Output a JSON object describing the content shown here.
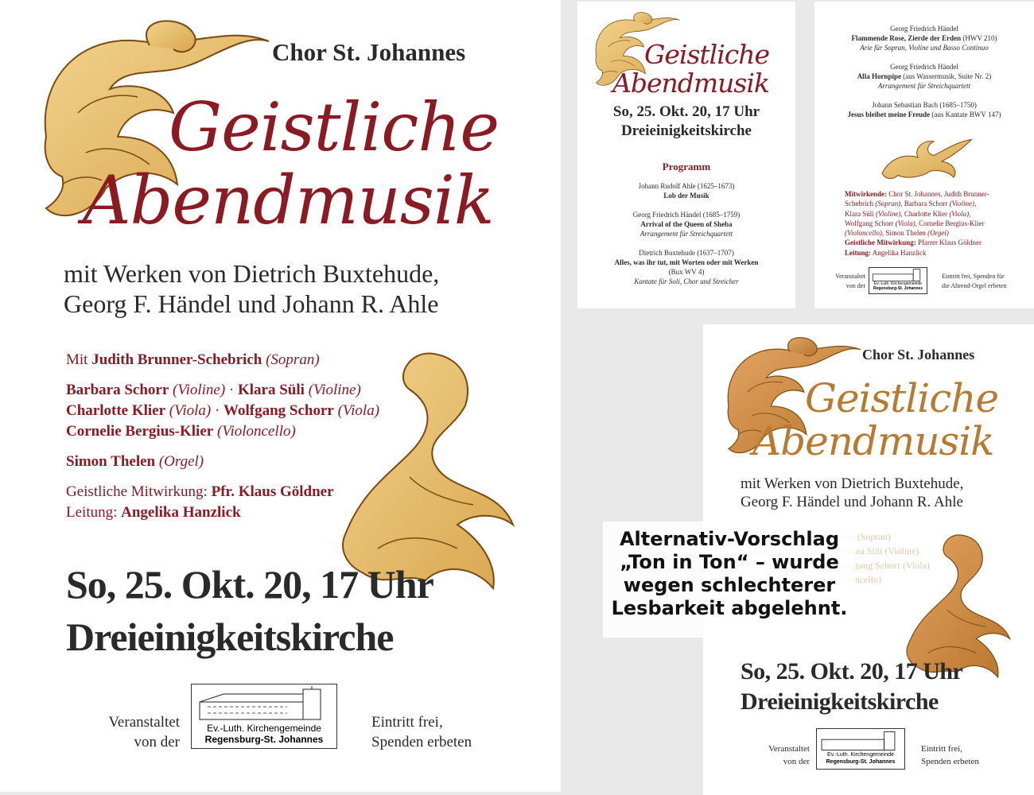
{
  "main": {
    "choir": "Chor St. Johannes",
    "title1": "Geistliche",
    "title2": "Abendmusik",
    "sub1": "mit Werken von Dietrich Buxtehude,",
    "sub2": "Georg F. Händel und Johann R. Ahle",
    "cast": {
      "mit": "Mit",
      "judith": "Judith Brunner-Schebrich",
      "sopran": "(Sopran)",
      "barbara": "Barbara Schorr",
      "violine": "(Violine)",
      "dot": " · ",
      "klara": "Klara Süli",
      "charlotte": "Charlotte Klier",
      "viola": "(Viola)",
      "wolfgang": "Wolfgang Schorr",
      "cornelie": "Cornelie Bergius-Klier",
      "violoncello": "(Violoncello)",
      "simon": "Simon Thelen",
      "orgel": "(Orgel)",
      "mitwirkung_label": "Geistliche Mitwirkung:",
      "mitwirkung": "Pfr. Klaus Göldner",
      "leitung_label": "Leitung:",
      "leitung": "Angelika Hanzlick"
    },
    "date": "So, 25. Okt. 20, 17 Uhr",
    "venue": "Dreieinigkeitskirche",
    "veranstaltet1": "Veranstaltet",
    "veranstaltet2": "von der",
    "logo1": "Ev.-Luth. Kirchengemeinde",
    "logo2": "Regensburg-St. Johannes",
    "eintritt1": "Eintritt frei,",
    "eintritt2": "Spenden erbeten"
  },
  "flyer_front": {
    "title1": "Geistliche",
    "title2": "Abendmusik",
    "date": "So, 25. Okt. 20, 17 Uhr",
    "venue": "Dreieinigkeitskirche",
    "programm": "Programm",
    "p1_composer": "Johann Rudolf Ahle (1625–1673)",
    "p1_work": "Lob der Musik",
    "p2_composer": "Georg Friedrich Händel (1685–1759)",
    "p2_work": "Arrival of the Queen of Sheba",
    "p2_note": "Arrangement für Streichquartett",
    "p3_composer": "Dietrich Buxtehude (1637–1707)",
    "p3_work": "Alles, was ihr tut, mit Worten oder mit Werken",
    "p3_bux": "(Bux WV 4)",
    "p3_note": "Kantate für Soli, Chor und Streicher"
  },
  "flyer_back": {
    "p4_composer": "Georg Friedrich Händel",
    "p4_work": "Flammende Rose, Zierde der Erden",
    "p4_hwv": "(HWV 210)",
    "p4_note": "Arie für Sopran, Violine und Basso Continuo",
    "p5_composer": "Georg Friedrich Händel",
    "p5_work": "Alla Hornpipe",
    "p5_paren": "(aus Wassermusik, Suite Nr. 2)",
    "p5_note": "Arrangement für Streichquartett",
    "p6_composer": "Johann Sebastian Bach (1685–1750)",
    "p6_work": "Jesus bleibet meine Freude",
    "p6_paren": "(aus Kantate BWV 147)",
    "mitwirkende_label": "Mitwirkende:",
    "m1": "Chor St. Johannes, Judith Brunner-",
    "m2a": "Schebrich",
    "m2b": "(Sopran)",
    "m2c": ", Barbara Schorr",
    "m2d": "(Violine)",
    "m3a": "Klara Süli",
    "m3b": "(Violine)",
    "m3c": ", Charlotte Klier",
    "m3d": "(Viola)",
    "m4a": "Wolfgang Schorr",
    "m4b": "(Viola)",
    "m4c": ", Cornelie Bergius-Klier",
    "m5a": "(Violoncello)",
    "m5b": ", Simon Thelen",
    "m5c": "(Orgel)",
    "gm_label": "Geistliche Mitwirkung:",
    "gm": "Pfarrer Klaus Göldner",
    "le_label": "Leitung:",
    "le": "Angelika Hanzlick",
    "veranstaltet1": "Veranstaltet",
    "veranstaltet2": "von der",
    "logo1": "Ev.-Luth. Kirchengemeinde",
    "logo2": "Regensburg-St. Johannes",
    "eintritt1": "Eintritt frei, Spenden für",
    "eintritt2": "die Ahrend-Orgel erbeten"
  },
  "alt": {
    "choir": "Chor St. Johannes",
    "title1": "Geistliche",
    "title2": "Abendmusik",
    "sub1": "mit Werken von Dietrich Buxtehude,",
    "sub2": "Georg F. Händel und Johann R. Ahle",
    "ghost1": "Mit Judith Brunner-Schebrich (Sopran)",
    "ghost2": "Barbara Schorr (Violine) · Klara Süli (Violine)",
    "ghost3": "Charlotte Klier (Viola) · Wolfgang Schorr (Viola)",
    "ghost4": "Cornelie Bergius-Klier (Violoncello)",
    "date": "So, 25. Okt. 20, 17 Uhr",
    "venue": "Dreieinigkeitskirche",
    "veranstaltet1": "Veranstaltet",
    "veranstaltet2": "von der",
    "logo1": "Ev.-Luth. Kirchengemeinde",
    "logo2": "Regensburg-St. Johannes",
    "eintritt1": "Eintritt frei,",
    "eintritt2": "Spenden erbeten",
    "overlay1": "Alternativ-Vorschlag",
    "overlay2": "„Ton in Ton“ – wurde",
    "overlay3": "wegen schlechterer",
    "overlay4": "Lesbarkeit abgelehnt."
  },
  "colors": {
    "accent": "#8b1a22",
    "gold": "#e4bb6b",
    "gold_dark": "#b87a2e"
  }
}
